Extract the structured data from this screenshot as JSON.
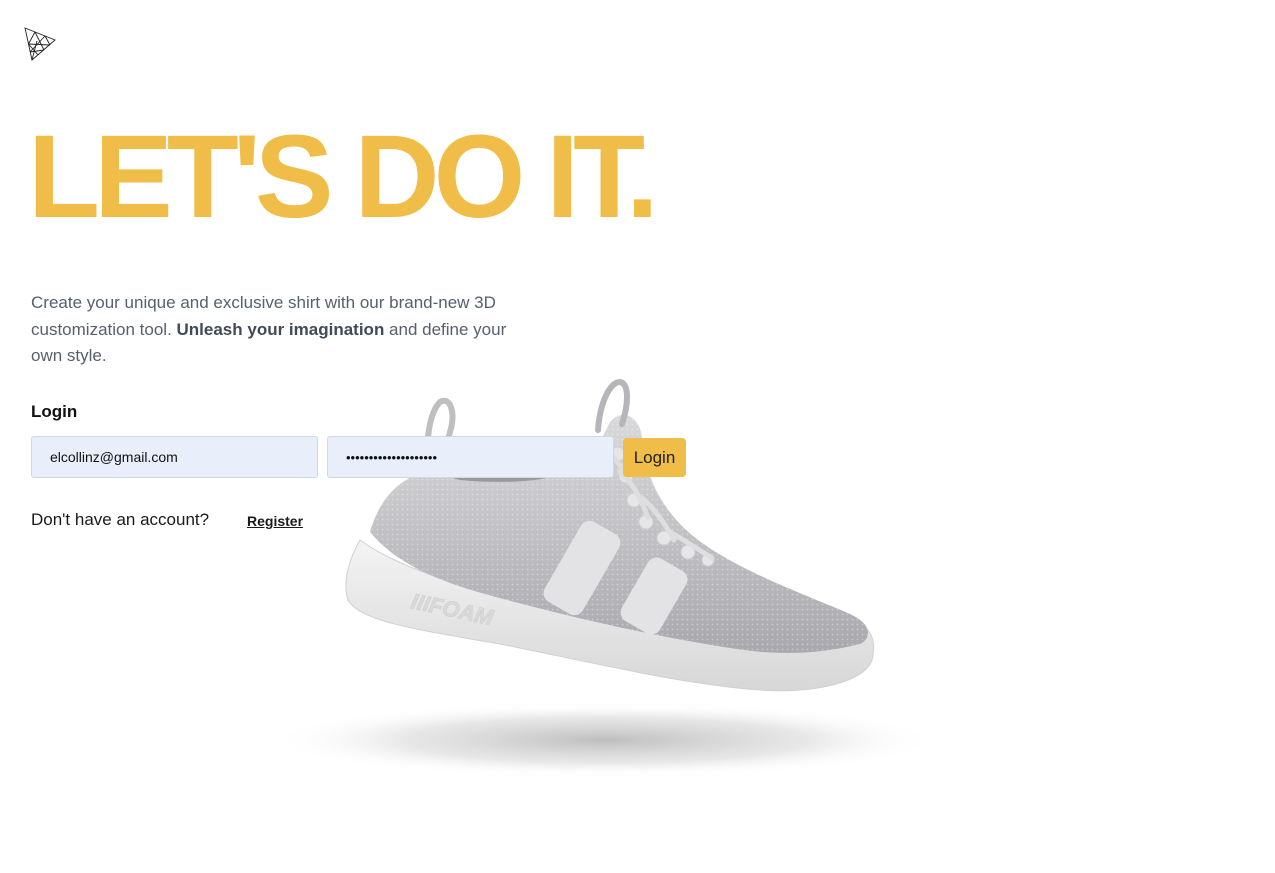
{
  "hero": {
    "title": "LET'S DO IT."
  },
  "intro": {
    "text_before": "Create your unique and exclusive shirt with our brand-new 3D customization tool. ",
    "emphasis": "Unleash your imagination",
    "text_after": " and define your own style."
  },
  "login": {
    "heading": "Login",
    "email_value": "elcollinz@gmail.com",
    "password_value": "••••••••••••••••••••",
    "submit_label": "Login"
  },
  "signup": {
    "prompt": "Don't have an account?",
    "register_label": "Register"
  },
  "product": {
    "sole_text": "IIIFOAM"
  },
  "colors": {
    "accent": "#f0bd48",
    "input_bg": "#e8effb",
    "body_text": "#56606e"
  },
  "icons": {
    "logo": "triangle-mesh-logo-icon"
  }
}
